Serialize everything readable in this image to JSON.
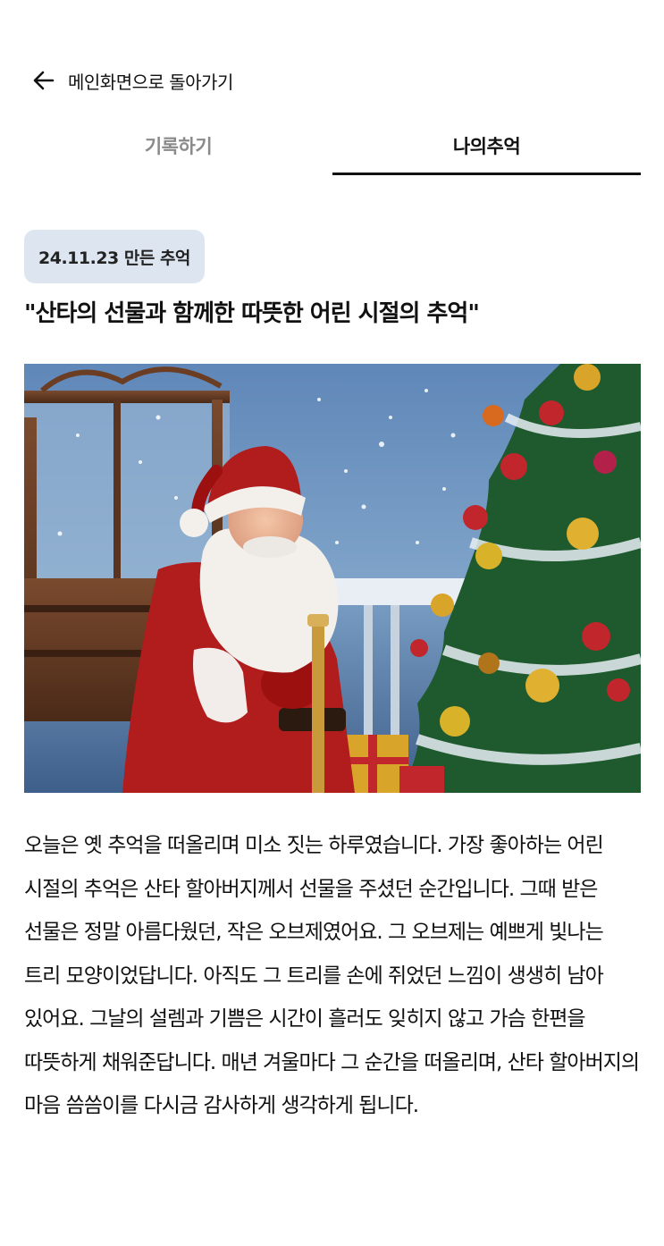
{
  "header": {
    "back_icon": "arrow-left-icon",
    "back_label": "메인화면으로 돌아가기"
  },
  "tabs": [
    {
      "label": "기록하기",
      "active": false
    },
    {
      "label": "나의추억",
      "active": true
    }
  ],
  "memory": {
    "date_badge": "24.11.23 만든 추억",
    "title": "\"산타의 선물과 함께한 따뜻한 어린 시절의 추억\"",
    "body": "오늘은 옛 추억을 떠올리며 미소 짓는 하루였습니다. 가장 좋아하는 어린 시절의 추억은 산타 할아버지께서 선물을 주셨던 순간입니다. 그때 받은 선물은 정말 아름다웠던, 작은 오브제였어요. 그 오브제는 예쁘게 빛나는 트리 모양이었답니다. 아직도 그 트리를 손에 쥐었던 느낌이 생생히 남아 있어요. 그날의 설렘과 기쁨은 시간이 흘러도 잊히지 않고 가슴 한편을 따뜻하게 채워준답니다. 매년 겨울마다 그 순간을 떠올리며, 산타 할아버지의 마음 씀씀이를 다시금 감사하게 생각하게 됩니다."
  },
  "colors": {
    "badge_bg": "#dde6f0",
    "active_tab": "#111111",
    "inactive_tab": "#8a8a8a"
  }
}
